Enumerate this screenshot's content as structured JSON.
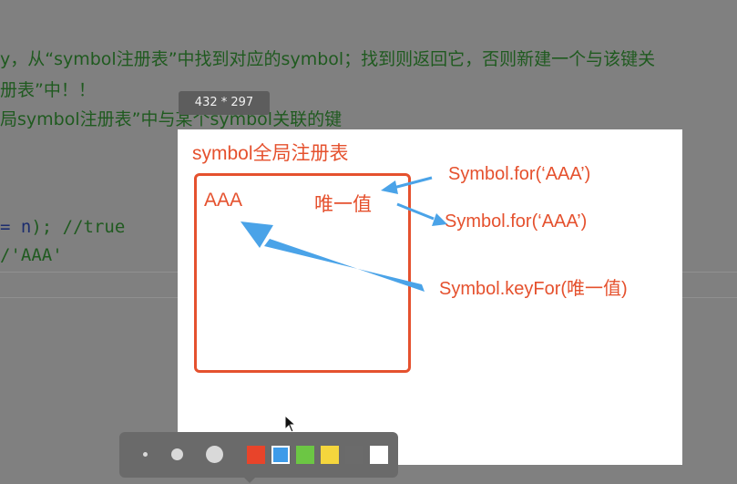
{
  "code": {
    "line1": "y，从“symbol注册表”中找到对应的symbol；找到则返回它，否则新建一个与该键关",
    "line2": "册表”中！！",
    "line3": "局symbol注册表”中与某个symbol关联的键",
    "line4_pre": "= ",
    "line4_var": "n",
    "line4_post": "); //true",
    "line5": "/'AAA'"
  },
  "size_tooltip": "432 * 297",
  "annotations": {
    "title": "symbol全局注册表",
    "key": "AAA",
    "value": "唯一值",
    "call1": "Symbol.for(‘AAA’)",
    "call2": "Symbol.for(‘AAA’)",
    "call3": "Symbol.keyFor(唯一值)"
  },
  "colors": {
    "annotation_red": "#e5512e",
    "arrow_blue": "#4aa3e8",
    "swatches": [
      "#e8442a",
      "#3d9be9",
      "#6cc644",
      "#f5d63d",
      "#6b6b6b",
      "#ffffff"
    ],
    "selected_swatch": "#3d9be9"
  },
  "toolbar": {
    "brush_sizes": [
      "small",
      "medium",
      "large"
    ],
    "swatch_names": [
      "red",
      "blue",
      "green",
      "yellow",
      "gray",
      "white"
    ]
  }
}
